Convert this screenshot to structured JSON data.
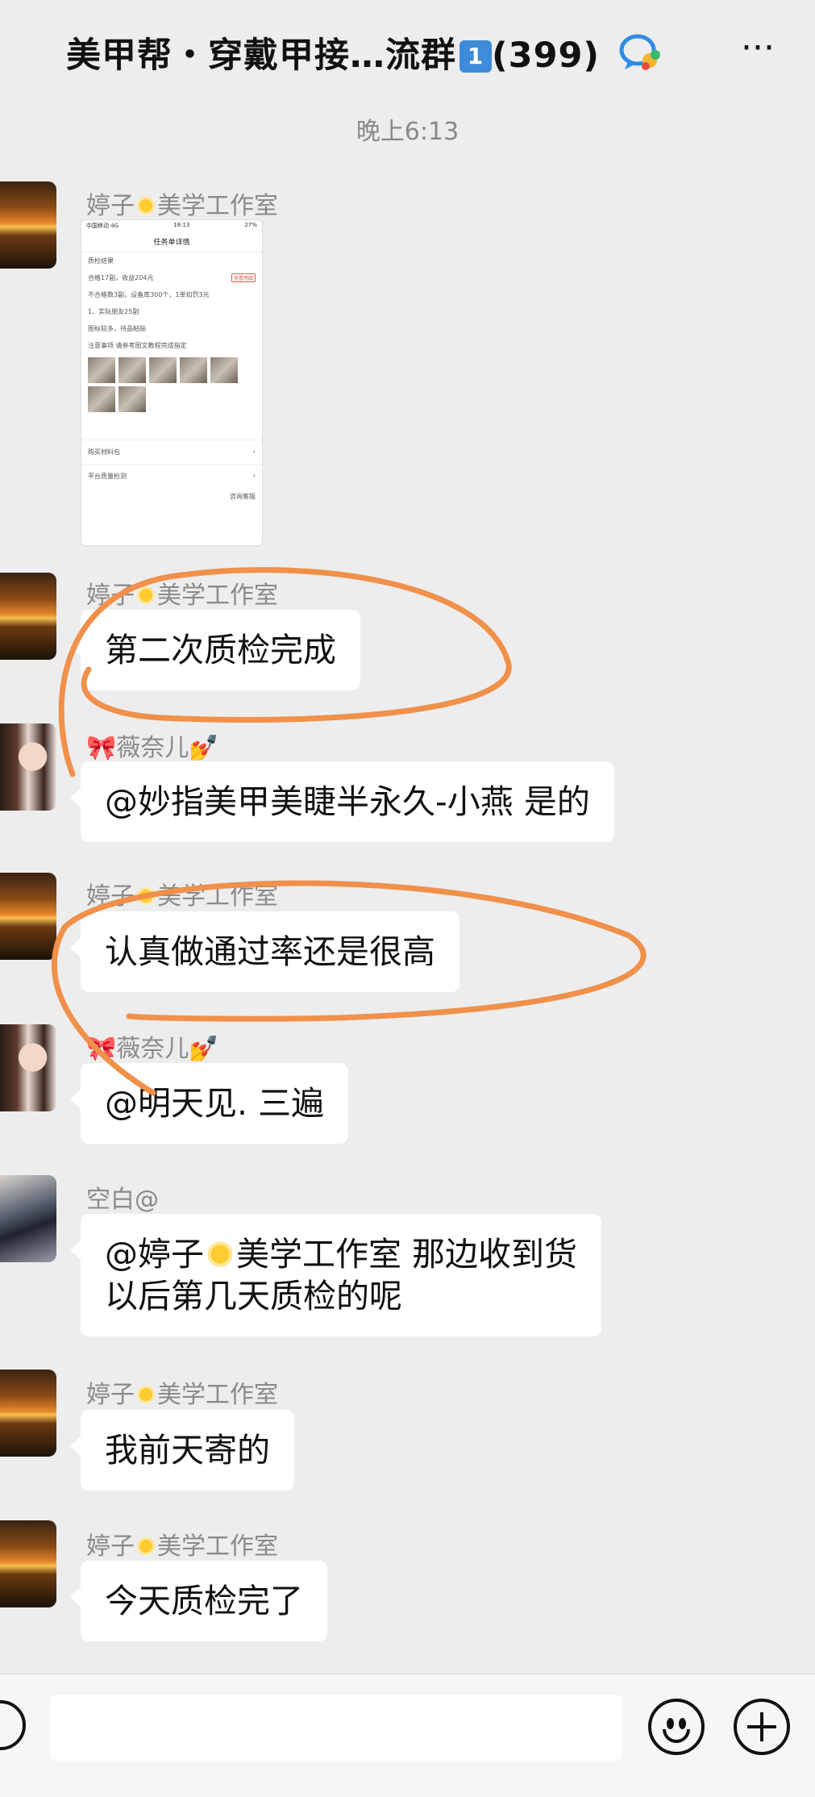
{
  "header": {
    "title": "美甲帮・穿戴甲接…流群",
    "badge": "1",
    "member_count": "(399)",
    "more_label": "···"
  },
  "timestamp": "晚上6:13",
  "image_message": {
    "sender": "婷子",
    "sender_suffix": "美学工作室",
    "screenshot": {
      "status_left": "中国移动 4G",
      "status_center": "18:13",
      "status_right": "27%",
      "title": "任务单详情",
      "line1": "质检结果",
      "line2": "合格17副，收益204元",
      "tag": "查看明细",
      "line3": "不合格数3副，设备库300个，1单扣罚3元",
      "line4": "1、实际朋友25副",
      "line5": "图标较多，待品粘贴",
      "line6": "注意事项 请参考图文教程完成指定",
      "row1": "购买材料包",
      "row2": "平台质量检测",
      "footer": "咨询客服"
    }
  },
  "messages": [
    {
      "sender": "婷子",
      "sender_suffix": "美学工作室",
      "avatar": "sunset",
      "text": "第二次质检完成"
    },
    {
      "sender": "🎀薇奈儿💅",
      "avatar": "girl",
      "text": "@妙指美甲美睫半永久-小燕  是的"
    },
    {
      "sender": "婷子",
      "sender_suffix": "美学工作室",
      "avatar": "sunset",
      "text": "认真做通过率还是很高"
    },
    {
      "sender": "🎀薇奈儿💅",
      "avatar": "girl",
      "text": "@明天见. 三遍"
    },
    {
      "sender": "空白@",
      "avatar": "blank",
      "text_line1_a": "@婷子",
      "text_line1_b": "美学工作室  那边收到货",
      "text_line2": "以后第几天质检的呢"
    },
    {
      "sender": "婷子",
      "sender_suffix": "美学工作室",
      "avatar": "sunset",
      "text": "我前天寄的"
    },
    {
      "sender": "婷子",
      "sender_suffix": "美学工作室",
      "avatar": "sunset",
      "text": "今天质检完了"
    }
  ],
  "input": {
    "placeholder": ""
  },
  "colors": {
    "background": "#ededed",
    "bubble": "#ffffff",
    "annotation": "#f0904a"
  }
}
